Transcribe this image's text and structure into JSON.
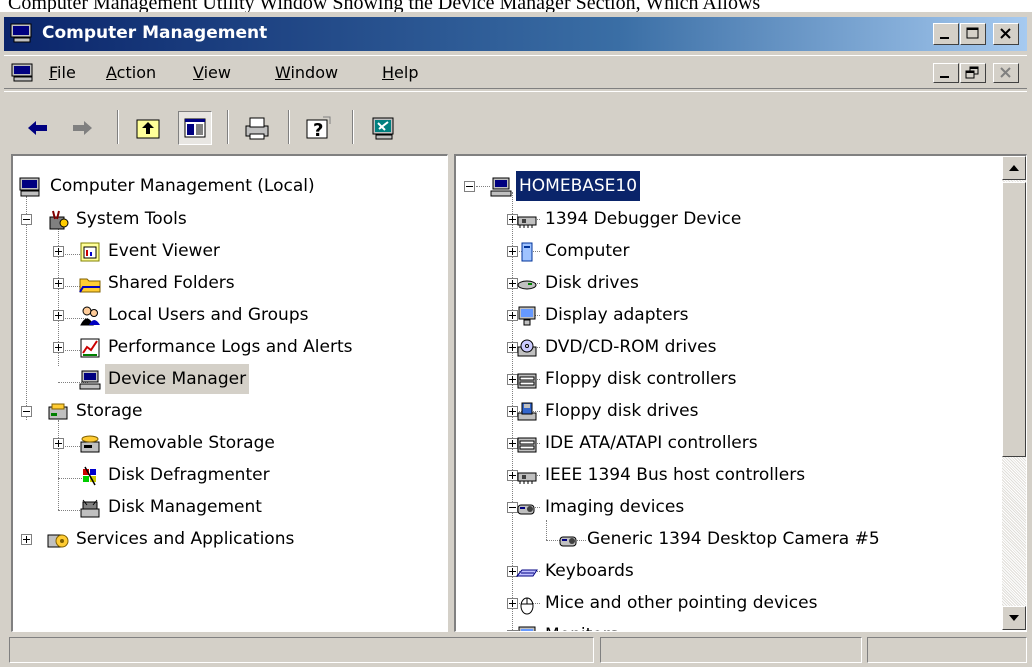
{
  "doc_text": "Computer Management Utility Window Showing the Device Manager Section, Which Allows",
  "window": {
    "title": "Computer Management"
  },
  "menubar": {
    "items": [
      {
        "label": "File",
        "accel": "F",
        "rest": "ile"
      },
      {
        "label": "Action",
        "accel": "A",
        "rest": "ction"
      },
      {
        "label": "View",
        "accel": "V",
        "rest": "iew"
      },
      {
        "label": "Window",
        "accel": "W",
        "rest": "indow"
      },
      {
        "label": "Help",
        "accel": "H",
        "rest": "elp"
      }
    ]
  },
  "toolbar": {
    "buttons": [
      "back-icon",
      "forward-icon",
      "up-folder-icon",
      "show-hide-tree-icon",
      "print-icon",
      "help-icon",
      "properties-icon"
    ]
  },
  "tree": {
    "root": "Computer Management (Local)",
    "system_tools": "System Tools",
    "event_viewer": "Event Viewer",
    "shared_folders": "Shared Folders",
    "local_users": "Local Users and Groups",
    "perf_logs": "Performance Logs and Alerts",
    "device_manager": "Device Manager",
    "storage": "Storage",
    "removable_storage": "Removable Storage",
    "disk_defrag": "Disk Defragmenter",
    "disk_management": "Disk Management",
    "services": "Services and Applications"
  },
  "devices": {
    "root": "HOMEBASE10",
    "items": [
      {
        "label": "1394 Debugger Device",
        "expander": "plus",
        "icon": "network-card-icon"
      },
      {
        "label": "Computer",
        "expander": "plus",
        "icon": "computer-icon"
      },
      {
        "label": "Disk drives",
        "expander": "plus",
        "icon": "disk-drive-icon"
      },
      {
        "label": "Display adapters",
        "expander": "plus",
        "icon": "monitor-icon"
      },
      {
        "label": "DVD/CD-ROM drives",
        "expander": "plus",
        "icon": "cd-drive-icon"
      },
      {
        "label": "Floppy disk controllers",
        "expander": "plus",
        "icon": "controller-icon"
      },
      {
        "label": "Floppy disk drives",
        "expander": "plus",
        "icon": "floppy-icon"
      },
      {
        "label": "IDE ATA/ATAPI controllers",
        "expander": "plus",
        "icon": "controller-icon"
      },
      {
        "label": "IEEE 1394 Bus host controllers",
        "expander": "plus",
        "icon": "network-card-icon"
      },
      {
        "label": "Imaging devices",
        "expander": "minus",
        "icon": "camera-icon"
      },
      {
        "label": "Generic 1394 Desktop Camera #5",
        "expander": "none",
        "icon": "camera-icon"
      },
      {
        "label": "Keyboards",
        "expander": "plus",
        "icon": "keyboard-icon"
      },
      {
        "label": "Mice and other pointing devices",
        "expander": "plus",
        "icon": "mouse-icon"
      },
      {
        "label": "Monitors",
        "expander": "plus",
        "icon": "monitor-icon"
      }
    ]
  },
  "statusbar": {
    "panels": [
      "",
      "",
      ""
    ]
  }
}
